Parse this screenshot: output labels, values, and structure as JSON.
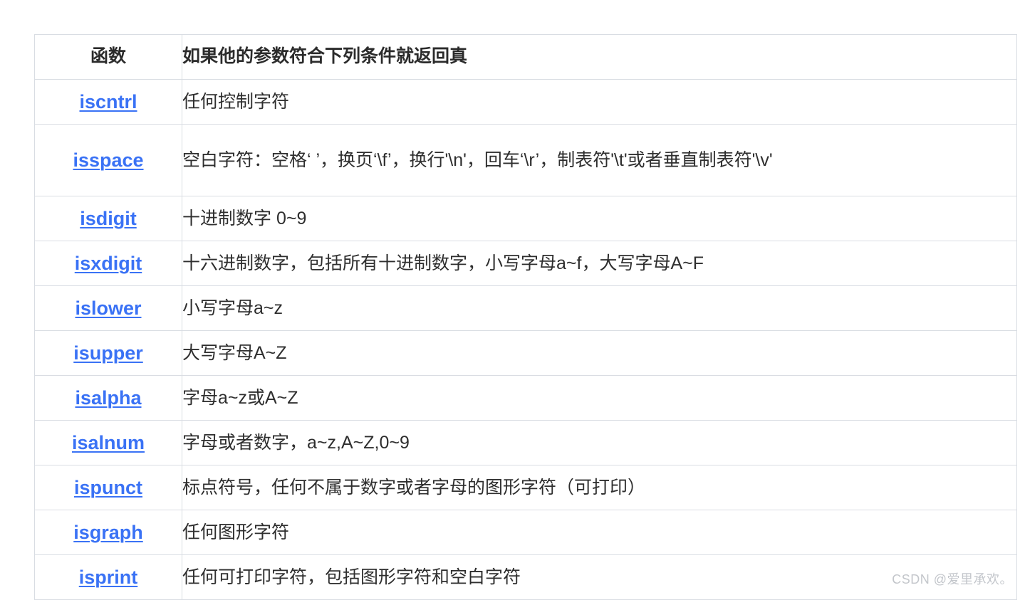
{
  "table": {
    "headers": {
      "function": "函数",
      "description": "如果他的参数符合下列条件就返回真"
    },
    "rows": [
      {
        "name": "iscntrl",
        "description": "任何控制字符",
        "tall": false
      },
      {
        "name": "isspace",
        "description": "空白字符：空格‘ ’，换页‘\\f’，换行'\\n'，回车‘\\r’，制表符'\\t'或者垂直制表符'\\v'",
        "tall": true
      },
      {
        "name": "isdigit",
        "description": "十进制数字 0~9",
        "tall": false
      },
      {
        "name": "isxdigit",
        "description": "十六进制数字，包括所有十进制数字，小写字母a~f，大写字母A~F",
        "tall": false
      },
      {
        "name": "islower",
        "description": "小写字母a~z",
        "tall": false
      },
      {
        "name": "isupper",
        "description": "大写字母A~Z",
        "tall": false
      },
      {
        "name": "isalpha",
        "description": "字母a~z或A~Z",
        "tall": false
      },
      {
        "name": "isalnum",
        "description": "字母或者数字，a~z,A~Z,0~9",
        "tall": false
      },
      {
        "name": "ispunct",
        "description": "标点符号，任何不属于数字或者字母的图形字符（可打印）",
        "tall": false
      },
      {
        "name": "isgraph",
        "description": "任何图形字符",
        "tall": false
      },
      {
        "name": "isprint",
        "description": "任何可打印字符，包括图形字符和空白字符",
        "tall": false
      }
    ]
  },
  "watermark": {
    "text": "CSDN @爱里承欢。"
  },
  "colors": {
    "link": "#3a72f5",
    "text": "#2e2e2e",
    "header_text": "#2b2b2b",
    "border": "#d9dde3",
    "background": "#ffffff",
    "watermark": "#c3c6cb"
  }
}
